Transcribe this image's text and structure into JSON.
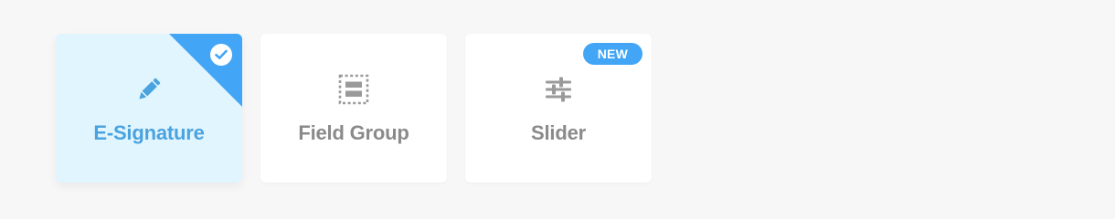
{
  "colors": {
    "page_background": "#f7f7f7",
    "accent": "#42a5f5",
    "selected_card_background": "#e1f5fe",
    "selected_label": "#4aa3df",
    "muted": "#8a8a8a"
  },
  "cards": [
    {
      "label": "E-Signature",
      "icon": "pencil-icon",
      "selected": true,
      "selection_indicator_icon": "checkmark-icon"
    },
    {
      "label": "Field Group",
      "icon": "field-group-icon",
      "selected": false
    },
    {
      "label": "Slider",
      "icon": "sliders-icon",
      "selected": false,
      "badge": "NEW"
    }
  ]
}
